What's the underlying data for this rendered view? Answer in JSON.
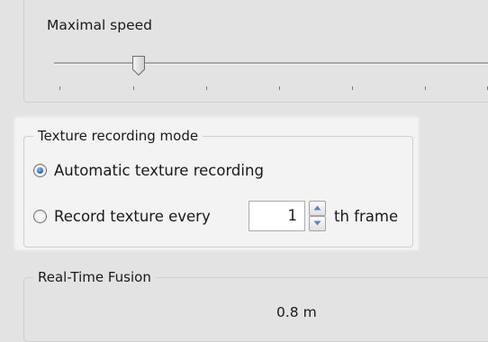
{
  "speed": {
    "title": "Maximal speed",
    "value_fraction": 0.19,
    "tick_count": 7
  },
  "texture": {
    "title": "Texture recording mode",
    "option_auto": "Automatic texture recording",
    "option_every": "Record texture every",
    "selected": "auto",
    "frame_value": "1",
    "frame_suffix": "th frame"
  },
  "fusion": {
    "title": "Real-Time Fusion",
    "value": "0.8 m"
  },
  "colors": {
    "window_bg": "#e3e3e3",
    "highlight_panel": "#f3f3f3",
    "radio_selected": "#2b6cb8"
  }
}
